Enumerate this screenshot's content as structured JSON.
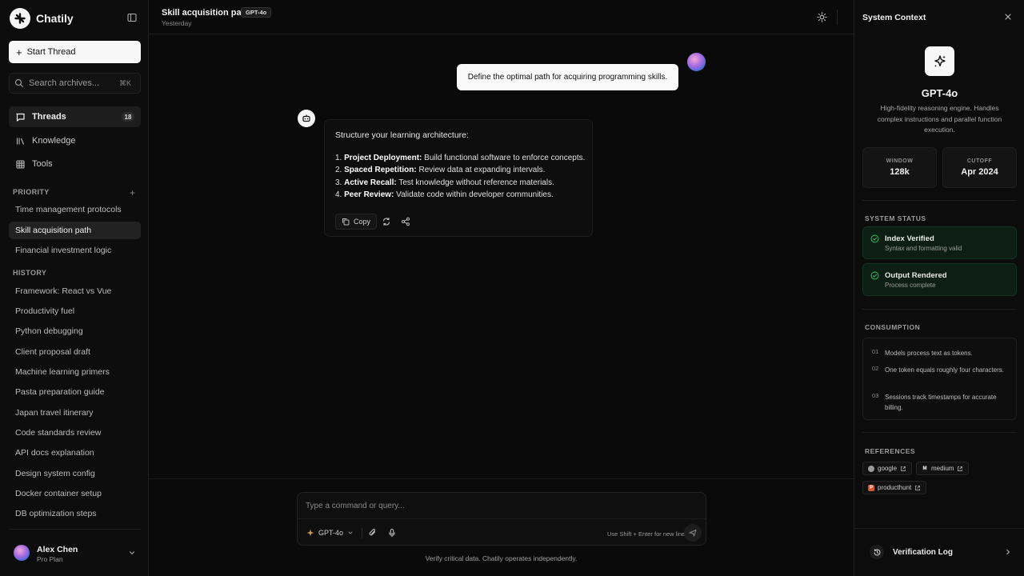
{
  "app": {
    "name": "Chatily",
    "logo_icon": "asterisk-icon"
  },
  "sidebar": {
    "start_thread_label": "Start Thread",
    "search_placeholder": "Search archives...",
    "search_shortcut": "⌘K",
    "nav": [
      {
        "label": "Threads",
        "icon": "chat-icon",
        "badge": "18",
        "active": true
      },
      {
        "label": "Knowledge",
        "icon": "library-icon"
      },
      {
        "label": "Tools",
        "icon": "grid-icon"
      }
    ],
    "priority_label": "PRIORITY",
    "priority_add": "+",
    "priority_items": [
      "Time management protocols",
      "Skill acquisition path",
      "Financial investment logic"
    ],
    "history_label": "HISTORY",
    "history_items": [
      "Framework: React vs Vue",
      "Productivity fuel",
      "Python debugging",
      "Client proposal draft",
      "Machine learning primers",
      "Pasta preparation guide",
      "Japan travel itinerary",
      "Code standards review",
      "API docs explanation",
      "Design system config",
      "Docker container setup",
      "DB optimization steps"
    ],
    "user": {
      "name": "Alex Chen",
      "plan": "Pro Plan"
    }
  },
  "header": {
    "title": "Skill acquisition path",
    "model_badge": "GPT-4o",
    "date": "Yesterday"
  },
  "chat": {
    "user_message": "Define the optimal path for acquiring programming skills.",
    "assistant": {
      "intro": "Structure your learning architecture:",
      "items": [
        {
          "num": "1.",
          "title": "Project Deployment:",
          "text": " Build functional software to enforce concepts."
        },
        {
          "num": "2.",
          "title": "Spaced Repetition:",
          "text": " Review data at expanding intervals."
        },
        {
          "num": "3.",
          "title": "Active Recall:",
          "text": " Test knowledge without reference materials."
        },
        {
          "num": "4.",
          "title": "Peer Review:",
          "text": " Validate code within developer communities."
        }
      ],
      "copy_label": "Copy"
    }
  },
  "composer": {
    "placeholder": "Type a command or query...",
    "model": "GPT-4o",
    "hint": "Use Shift + Enter for new line",
    "disclaimer": "Verify critical data. Chatily operates independently."
  },
  "context_panel": {
    "title": "System Context",
    "model_name": "GPT-4o",
    "model_desc": "High-fidelity reasoning engine. Handles complex instructions and parallel function execution.",
    "stats": [
      {
        "label": "WINDOW",
        "value": "128k"
      },
      {
        "label": "CUTOFF",
        "value": "Apr 2024"
      }
    ],
    "status_label": "SYSTEM STATUS",
    "statuses": [
      {
        "title": "Index Verified",
        "sub": "Syntax and formatting valid"
      },
      {
        "title": "Output Rendered",
        "sub": "Process complete"
      }
    ],
    "consumption_label": "CONSUMPTION",
    "consumption": [
      {
        "num": "01",
        "text": "Models process text as tokens."
      },
      {
        "num": "02",
        "text": "One token equals roughly four characters."
      },
      {
        "num": "03",
        "text": "Sessions track timestamps for accurate billing."
      }
    ],
    "references_label": "REFERENCES",
    "references": [
      {
        "name": "google",
        "color": "#9a9a9a"
      },
      {
        "name": "medium",
        "color": "#1a1a1a"
      },
      {
        "name": "producthunt",
        "color": "#da552f"
      }
    ],
    "verification_label": "Verification Log"
  },
  "colors": {
    "accent": "#f7f7f7",
    "success": "#22c55e",
    "background": "#0a0a0a"
  }
}
